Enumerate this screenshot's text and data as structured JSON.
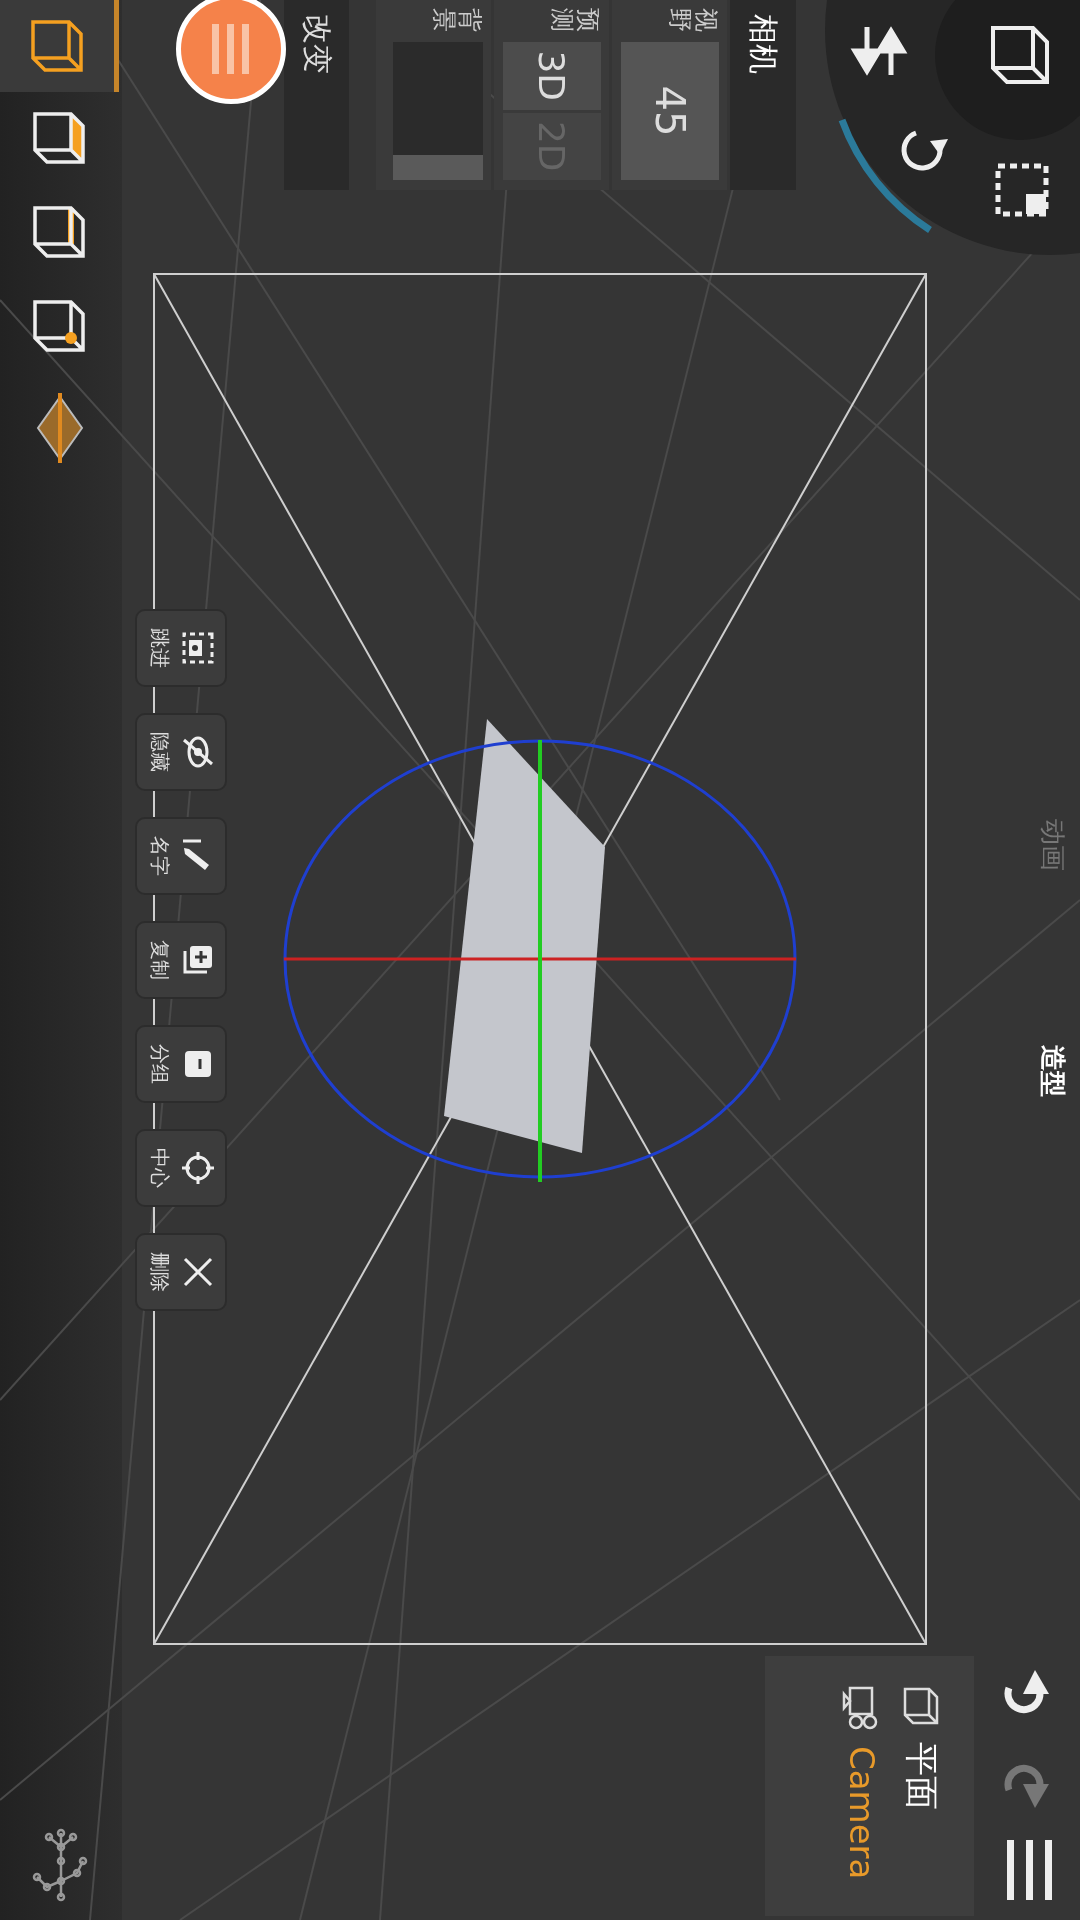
{
  "mode_tabs": [
    {
      "label": "动画",
      "selected": false
    },
    {
      "label": "造型",
      "selected": true
    }
  ],
  "camera_panel": {
    "title": "相机",
    "fov": {
      "label": "视野",
      "value": "45"
    },
    "projection": {
      "label": "预测",
      "options": [
        {
          "label": "3D",
          "selected": true
        },
        {
          "label": "2D",
          "selected": false
        }
      ]
    },
    "background": {
      "label": "背景"
    }
  },
  "transform_button": {
    "label": "改变"
  },
  "select_modes": [
    {
      "kind": "object",
      "selected": true
    },
    {
      "kind": "face",
      "selected": false
    },
    {
      "kind": "edge",
      "selected": false
    },
    {
      "kind": "vertex",
      "selected": false
    }
  ],
  "selection_tools": [
    {
      "kind": "focus",
      "label": "跳进"
    },
    {
      "kind": "hide",
      "label": "隐藏"
    },
    {
      "kind": "rename",
      "label": "名字"
    },
    {
      "kind": "duplicate",
      "label": "复制"
    },
    {
      "kind": "group",
      "label": "分组"
    },
    {
      "kind": "center",
      "label": "中心"
    },
    {
      "kind": "delete",
      "label": "删除"
    }
  ],
  "outliner": {
    "items": [
      {
        "kind": "mesh",
        "label": "平面",
        "selected": false
      },
      {
        "kind": "camera",
        "label": "Camera",
        "selected": true
      }
    ]
  },
  "history": {
    "undo": {
      "disabled": false
    },
    "redo": {
      "disabled": true
    }
  }
}
